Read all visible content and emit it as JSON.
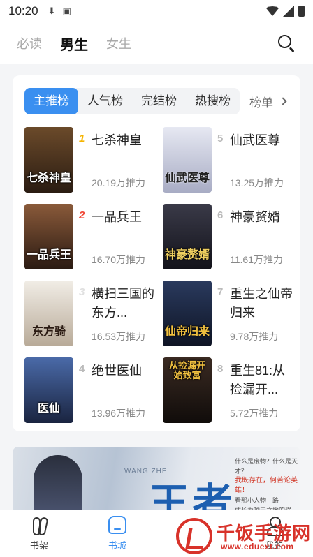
{
  "status_bar": {
    "time": "10:20",
    "icons": [
      "download-icon",
      "a-badge-icon"
    ]
  },
  "top_nav": {
    "tabs": [
      {
        "label": "必读",
        "active": false
      },
      {
        "label": "男生",
        "active": true
      },
      {
        "label": "女生",
        "active": false
      }
    ]
  },
  "rank": {
    "tabs": [
      {
        "label": "主推榜",
        "active": true
      },
      {
        "label": "人气榜",
        "active": false
      },
      {
        "label": "完结榜",
        "active": false
      },
      {
        "label": "热搜榜",
        "active": false
      }
    ],
    "more_label": "榜单",
    "books": [
      {
        "rank": "1",
        "title": "七杀神皇",
        "cover_text": "七杀神皇",
        "meta": "20.19万推力",
        "cover": "#3a2a1e"
      },
      {
        "rank": "5",
        "title": "仙武医尊",
        "cover_text": "仙武医尊",
        "meta": "13.25万推力",
        "cover": "#c8cde0"
      },
      {
        "rank": "2",
        "title": "一品兵王",
        "cover_text": "一品兵王",
        "meta": "16.70万推力",
        "cover": "#5a3a2a"
      },
      {
        "rank": "6",
        "title": "神豪赘婿",
        "cover_text": "神豪赘婿",
        "meta": "11.61万推力",
        "cover": "#2a2a36"
      },
      {
        "rank": "3",
        "title": "横扫三国的东方...",
        "cover_text": "东方骑",
        "meta": "16.53万推力",
        "cover": "#e8e4dc"
      },
      {
        "rank": "7",
        "title": "重生之仙帝归来",
        "cover_text": "仙帝归来",
        "meta": "9.78万推力",
        "cover": "#1c2a44"
      },
      {
        "rank": "4",
        "title": "绝世医仙",
        "cover_text": "医仙",
        "meta": "13.96万推力",
        "cover": "#2b3f6e"
      },
      {
        "rank": "8",
        "title": "重生81:从捡漏开...",
        "cover_text": "从捡漏开始致富",
        "meta": "5.72万推力",
        "cover": "#1e1a18"
      }
    ]
  },
  "banner": {
    "title": "王者",
    "subtitle": "WANG ZHE",
    "text_lines": [
      "什么是废物？什么是天才？",
      "我既存在，何苦论英雄！",
      "看那小人物一路",
      "成长为顶天立地的强者！"
    ]
  },
  "bottom_nav": {
    "items": [
      {
        "label": "书架",
        "active": false
      },
      {
        "label": "书城",
        "active": true
      },
      {
        "label": "我的",
        "active": false
      }
    ]
  },
  "watermark": {
    "name": "千饭手游网",
    "url": "www.eduext.com"
  },
  "colors": {
    "accent": "#3a8ff0",
    "watermark_red": "#d8322a",
    "rank1": "#f5b400",
    "rank2": "#f04a3a"
  }
}
